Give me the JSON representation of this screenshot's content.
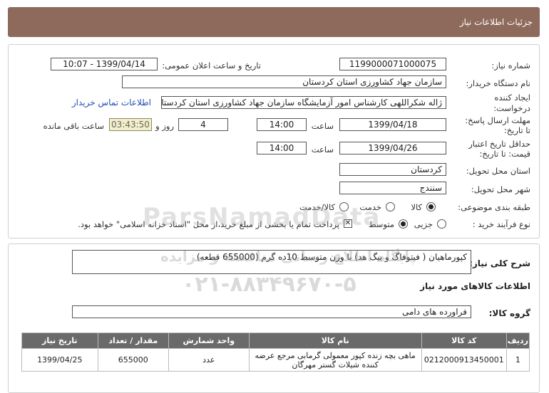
{
  "title": "جزئیات اطلاعات نیاز",
  "need_number": {
    "label": "شماره نیاز:",
    "value": "1199000071000075"
  },
  "announce_datetime": {
    "label": "تاریخ و ساعت اعلان عمومی:",
    "value": "1399/04/14 - 10:07"
  },
  "buyer_org": {
    "label": "نام دستگاه خریدار:",
    "value": "سازمان جهاد کشاورزی استان کردستان"
  },
  "requester": {
    "label_line1": "ایجاد کننده",
    "label_line2": "درخواست:",
    "value": "ژاله شکراللهی کارشناس امور آزمایشگاه سازمان جهاد کشاورزی استان کردستان",
    "contact_link": "اطلاعات تماس خریدار"
  },
  "reply_deadline": {
    "label_line1": "مهلت ارسال پاسخ:",
    "label_line2": "تا تاریخ:",
    "date": "1399/04/18",
    "time_label": "ساعت",
    "time": "14:00",
    "days": "4",
    "days_label": "روز و",
    "remaining": "03:43:50",
    "remaining_label": "ساعت باقی مانده"
  },
  "price_validity": {
    "label_line1": "حداقل تاریخ اعتبار",
    "label_line2": "قیمت: تا تاریخ:",
    "date": "1399/04/26",
    "time_label": "ساعت",
    "time": "14:00"
  },
  "delivery_province": {
    "label": "استان محل تحویل:",
    "value": "کردستان"
  },
  "delivery_city": {
    "label": "شهر محل تحویل:",
    "value": "سنندج"
  },
  "category": {
    "label": "طبقه بندی موضوعی:",
    "options": [
      "کالا",
      "خدمت",
      "کالا/خدمت"
    ],
    "selected": "کالا"
  },
  "purchase_process": {
    "label": "نوع فرآیند خرید :",
    "options": [
      "جزیی",
      "متوسط"
    ],
    "selected": "متوسط",
    "payment_note": "پرداخت تمام یا بخشی از مبلغ خرید،از محل \"اسناد خزانه اسلامی\" خواهد بود."
  },
  "general_description": {
    "label": "شرح کلی نیاز:",
    "value": "کپورماهیان ( فیتوفاگ و بیگ هد) با وزن متوسط 10ده گرم  (655000 قطعه)"
  },
  "goods_section_title": "اطلاعات کالاهای مورد نیاز",
  "goods_group": {
    "label": "گروه کالا:",
    "value": "فراورده های دامی"
  },
  "table": {
    "headers": [
      "ردیف",
      "کد کالا",
      "نام کالا",
      "واحد شمارش",
      "مقدار / تعداد",
      "تاریخ نیاز"
    ],
    "rows": [
      {
        "row": "1",
        "code": "0212000913450001",
        "name": "ماهی بچه زنده کپور معمولی گرمابی مرجع عرضه کننده شیلات گستر مهرگان",
        "unit": "عدد",
        "qty": "655000",
        "date": "1399/04/25"
      }
    ]
  },
  "watermark": {
    "line1": "ParsNamadData",
    "line2": "پایگاه اطلاع رسانی مناقصه و مزایده",
    "line3": "۰۲۱-۸۸۳۴۹۶۷۰-۵"
  }
}
